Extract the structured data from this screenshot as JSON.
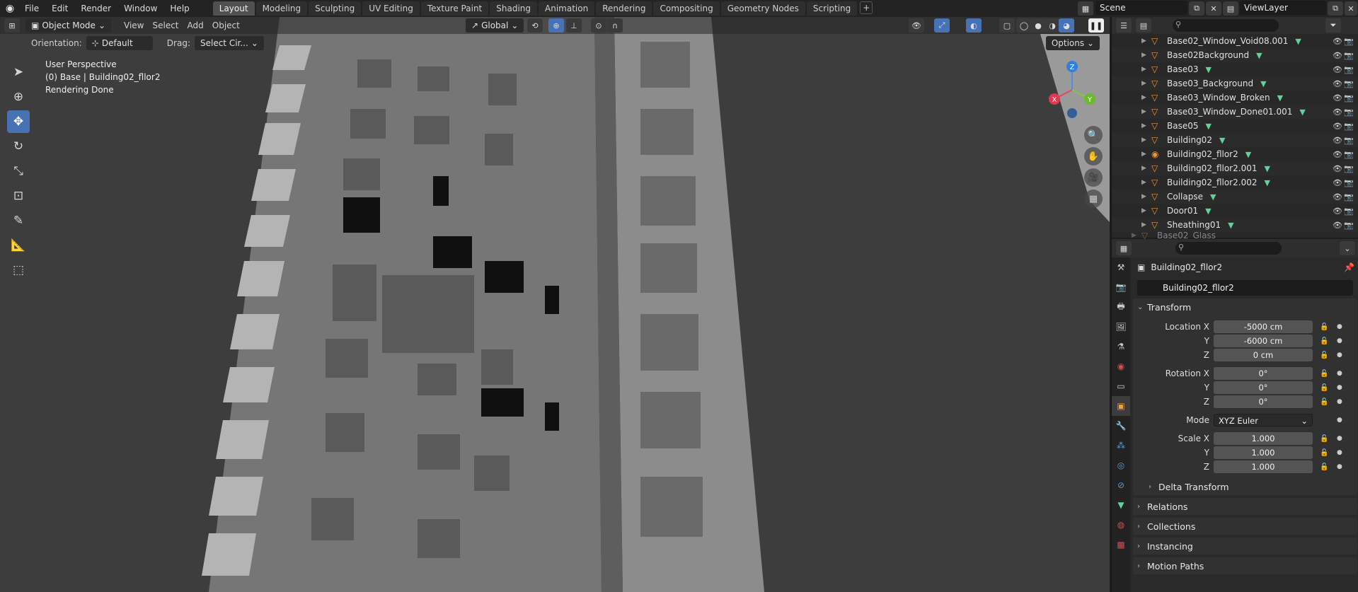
{
  "topbar": {
    "menus": [
      "File",
      "Edit",
      "Render",
      "Window",
      "Help"
    ],
    "workspaces": [
      "Layout",
      "Modeling",
      "Sculpting",
      "UV Editing",
      "Texture Paint",
      "Shading",
      "Animation",
      "Rendering",
      "Compositing",
      "Geometry Nodes",
      "Scripting"
    ],
    "active_workspace": "Layout",
    "scene": "Scene",
    "view_layer": "ViewLayer"
  },
  "viewport": {
    "mode": "Object Mode",
    "menus": [
      "View",
      "Select",
      "Add",
      "Object"
    ],
    "transform_orientation": "Global",
    "orientation_label": "Orientation:",
    "orientation_value": "Default",
    "drag_label": "Drag:",
    "drag_value": "Select Cir...",
    "options_label": "Options",
    "overlay_lines": [
      "User Perspective",
      "(0) Base | Building02_fllor2",
      "Rendering Done"
    ],
    "gizmo_axes": [
      "Z",
      "X",
      "Y"
    ]
  },
  "outliner": {
    "items": [
      "Base02_Window_Void08.001",
      "Base02Background",
      "Base03",
      "Base03_Background",
      "Base03_Window_Broken",
      "Base03_Window_Done01.001",
      "Base05",
      "Building02",
      "Building02_fllor2",
      "Building02_fllor2.001",
      "Building02_fllor2.002",
      "Collapse",
      "Door01",
      "Sheathing01",
      "Base02_Glass"
    ]
  },
  "properties": {
    "object_name": "Building02_fllor2",
    "name_field": "Building02_fllor2",
    "transform_title": "Transform",
    "location": {
      "label": "Location X",
      "x": "-5000 cm",
      "y": "-6000 cm",
      "z": "0 cm"
    },
    "rotation": {
      "label": "Rotation X",
      "x": "0°",
      "y": "0°",
      "z": "0°"
    },
    "mode_label": "Mode",
    "mode_value": "XYZ Euler",
    "scale": {
      "label": "Scale X",
      "x": "1.000",
      "y": "1.000",
      "z": "1.000"
    },
    "axis_y": "Y",
    "axis_z": "Z",
    "delta_transform": "Delta Transform",
    "panels": [
      "Relations",
      "Collections",
      "Instancing",
      "Motion Paths"
    ]
  }
}
